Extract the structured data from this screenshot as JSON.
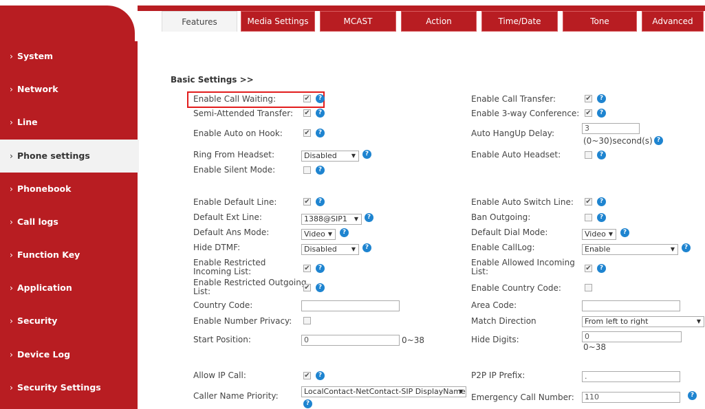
{
  "sidebar": {
    "items": [
      {
        "label": "System"
      },
      {
        "label": "Network"
      },
      {
        "label": "Line"
      },
      {
        "label": "Phone settings"
      },
      {
        "label": "Phonebook"
      },
      {
        "label": "Call logs"
      },
      {
        "label": "Function Key"
      },
      {
        "label": "Application"
      },
      {
        "label": "Security"
      },
      {
        "label": "Device Log"
      },
      {
        "label": "Security Settings"
      }
    ],
    "active_index": 3,
    "bullet": "›"
  },
  "tabs": [
    {
      "label": "Features"
    },
    {
      "label": "Media Settings"
    },
    {
      "label": "MCAST"
    },
    {
      "label": "Action"
    },
    {
      "label": "Time/Date"
    },
    {
      "label": "Tone"
    },
    {
      "label": "Advanced"
    }
  ],
  "section_title": "Basic Settings >>",
  "help_glyph": "?",
  "check_glyph": "✔",
  "caret_glyph": "▼",
  "left": {
    "enable_call_waiting": "Enable Call Waiting:",
    "semi_attended_transfer": "Semi-Attended Transfer:",
    "enable_auto_on_hook": "Enable Auto on Hook:",
    "ring_from_headset": "Ring From Headset:",
    "ring_from_headset_value": "Disabled",
    "enable_silent_mode": "Enable Silent Mode:",
    "enable_default_line": "Enable Default Line:",
    "default_ext_line": "Default Ext Line:",
    "default_ext_line_value": "1388@SIP1",
    "default_ans_mode": "Default Ans Mode:",
    "default_ans_mode_value": "Video",
    "hide_dtmf": "Hide DTMF:",
    "hide_dtmf_value": "Disabled",
    "enable_restricted_incoming_1": "Enable Restricted",
    "enable_restricted_incoming_2": "Incoming List:",
    "enable_restricted_outgoing_1": "Enable Restricted Outgoing",
    "enable_restricted_outgoing_2": "List:",
    "country_code": "Country Code:",
    "country_code_value": "",
    "enable_number_privacy": "Enable Number Privacy:",
    "start_position": "Start Position:",
    "start_position_value": "0",
    "start_position_range": "0~38",
    "allow_ip_call": "Allow IP Call:",
    "caller_name_priority": "Caller Name Priority:",
    "caller_name_priority_value": "LocalContact-NetContact-SIP DisplayName"
  },
  "right": {
    "enable_call_transfer": "Enable Call Transfer:",
    "enable_3way_conference": "Enable 3-way Conference:",
    "auto_hangup_delay": "Auto HangUp Delay:",
    "auto_hangup_delay_value": "3",
    "auto_hangup_delay_range": "(0~30)second(s)",
    "enable_auto_headset": "Enable Auto Headset:",
    "enable_auto_switch_line": "Enable Auto Switch Line:",
    "ban_outgoing": "Ban Outgoing:",
    "default_dial_mode": "Default Dial Mode:",
    "default_dial_mode_value": "Video",
    "enable_calllog": "Enable CallLog:",
    "enable_calllog_value": "Enable",
    "enable_allowed_incoming_1": "Enable Allowed Incoming",
    "enable_allowed_incoming_2": "List:",
    "enable_country_code": "Enable Country Code:",
    "area_code": "Area Code:",
    "area_code_value": "",
    "match_direction": "Match Direction",
    "match_direction_value": "From left to right",
    "hide_digits": "Hide Digits:",
    "hide_digits_value": "0",
    "hide_digits_range": "0~38",
    "p2p_ip_prefix": "P2P IP Prefix:",
    "p2p_ip_prefix_value": ".",
    "emergency_call_number": "Emergency Call Number:",
    "emergency_call_number_value": "110"
  },
  "colors": {
    "brand": "#b81d22",
    "help": "#1e84d0",
    "highlight": "#e21b1b"
  }
}
